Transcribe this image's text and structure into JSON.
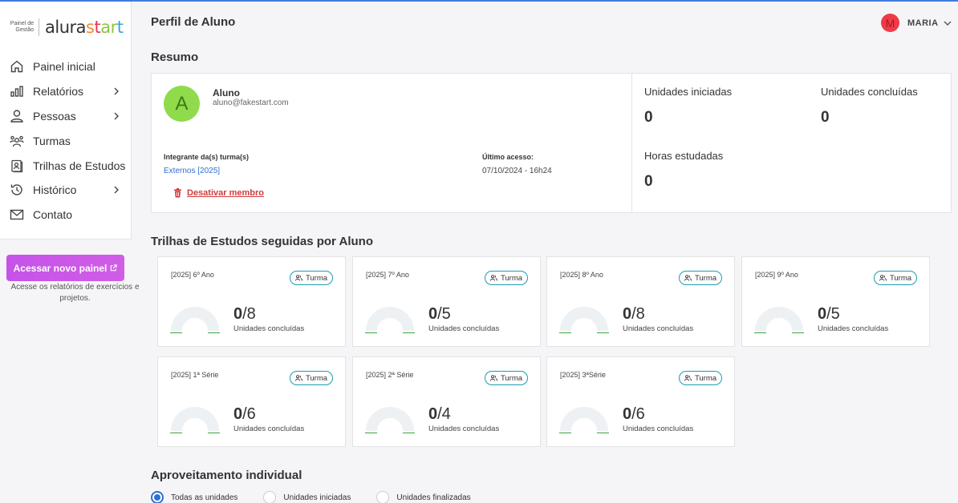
{
  "brand": {
    "subtitle_line1": "Painel de",
    "subtitle_line2": "Gestão",
    "word_part1": "alura",
    "word_part2": "s",
    "word_part3": "t",
    "word_part4": "ar",
    "word_part5": "t"
  },
  "nav": [
    {
      "label": "Painel inicial",
      "icon": "home-icon",
      "has_chevron": false
    },
    {
      "label": "Relatórios",
      "icon": "bar-chart-icon",
      "has_chevron": true
    },
    {
      "label": "Pessoas",
      "icon": "person-icon",
      "has_chevron": true
    },
    {
      "label": "Turmas",
      "icon": "group-icon",
      "has_chevron": false
    },
    {
      "label": "Trilhas de Estudos",
      "icon": "study-track-icon",
      "has_chevron": false
    },
    {
      "label": "Histórico",
      "icon": "history-icon",
      "has_chevron": true
    },
    {
      "label": "Contato",
      "icon": "mail-icon",
      "has_chevron": false
    }
  ],
  "cta": {
    "label": "Acessar novo painel",
    "hint": "Acesse os relatórios de exercícios e projetos."
  },
  "header": {
    "title": "Perfil de Aluno",
    "user_initial": "M",
    "user_name": "MARIA"
  },
  "summary": {
    "section_title": "Resumo",
    "student": {
      "initial": "A",
      "name": "Aluno",
      "email": "aluno@fakestart.com"
    },
    "groups_label": "Integrante da(s) turma(s)",
    "group_link": "Externos [2025]",
    "last_access_label": "Último acesso:",
    "last_access_value": "07/10/2024 - 16h24",
    "deactivate_label": "Desativar membro",
    "stats": {
      "started_label": "Unidades iniciadas",
      "started_value": "0",
      "completed_label": "Unidades concluídas",
      "completed_value": "0",
      "hours_label": "Horas estudadas",
      "hours_value": "0"
    }
  },
  "tracks_section_title": "Trilhas de Estudos seguidas por Aluno",
  "tracks": [
    {
      "name": "[2025] 6º Ano",
      "badge": "Turma",
      "done": "0",
      "total": "/8",
      "unit": "Unidades concluídas",
      "progress": 0
    },
    {
      "name": "[2025] 7º Ano",
      "badge": "Turma",
      "done": "0",
      "total": "/5",
      "unit": "Unidades concluídas",
      "progress": 0
    },
    {
      "name": "[2025] 8º Ano",
      "badge": "Turma",
      "done": "0",
      "total": "/8",
      "unit": "Unidades concluídas",
      "progress": 0
    },
    {
      "name": "[2025] 9º Ano",
      "badge": "Turma",
      "done": "0",
      "total": "/5",
      "unit": "Unidades concluídas",
      "progress": 0
    },
    {
      "name": "[2025] 1ª Série",
      "badge": "Turma",
      "done": "0",
      "total": "/6",
      "unit": "Unidades concluídas",
      "progress": 0
    },
    {
      "name": "[2025] 2ª Série",
      "badge": "Turma",
      "done": "0",
      "total": "/4",
      "unit": "Unidades concluídas",
      "progress": 0
    },
    {
      "name": "[2025] 3ªSérie",
      "badge": "Turma",
      "done": "0",
      "total": "/6",
      "unit": "Unidades concluídas",
      "progress": 0
    }
  ],
  "performance": {
    "section_title": "Aproveitamento individual",
    "options": [
      {
        "label": "Todas as unidades",
        "selected": true
      },
      {
        "label": "Unidades iniciadas",
        "selected": false
      },
      {
        "label": "Unidades finalizadas",
        "selected": false
      }
    ]
  },
  "colors": {
    "accent": "#2f6fd0",
    "cta": "#c553e8",
    "badge_border": "#1d9bb5",
    "danger": "#d23b3b",
    "gauge_track": "#eef1f4",
    "gauge_tick": "#4caf50"
  }
}
